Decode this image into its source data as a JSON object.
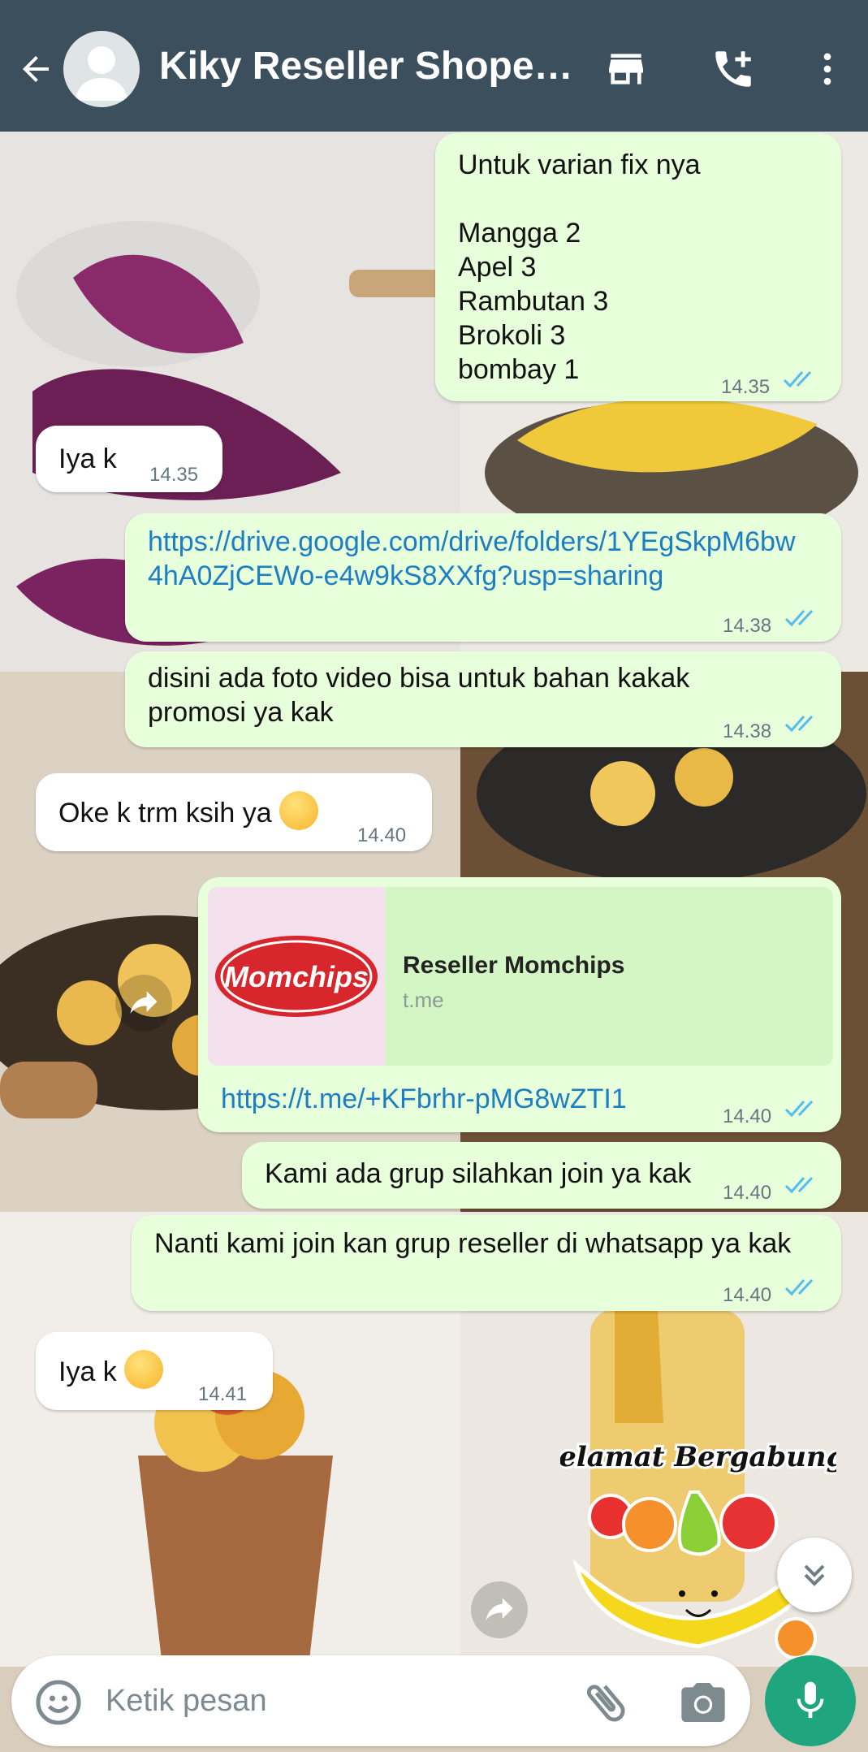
{
  "header": {
    "title": "Kiky Reseller Shopee...",
    "icons": [
      "back-arrow-icon",
      "avatar",
      "store-icon",
      "add-call-icon",
      "more-vert-icon"
    ]
  },
  "colors": {
    "header_bg": "#3c4f5c",
    "outgoing_bubble": "#e7ffdb",
    "incoming_bubble": "#ffffff",
    "link": "#1d7ec3",
    "read_ticks": "#53bdeb",
    "mic_button": "#1fa67f"
  },
  "messages": [
    {
      "direction": "out",
      "text": "Untuk varian fix nya\n\nMangga 2\nApel 3\nRambutan 3\nBrokoli 3\nbombay 1",
      "time": "14.35",
      "status": "read"
    },
    {
      "direction": "in",
      "text": "Iya k",
      "time": "14.35"
    },
    {
      "direction": "out",
      "text": "https://drive.google.com/drive/folders/1YEgSkpM6bw4hA0ZjCEWo-e4w9kS8XXfg?usp=sharing",
      "time": "14.38",
      "status": "read",
      "is_link": true
    },
    {
      "direction": "out",
      "text": "disini ada foto video bisa untuk bahan kakak promosi ya kak",
      "time": "14.38",
      "status": "read"
    },
    {
      "direction": "in",
      "text": "Oke k trm ksih ya",
      "emoji": "smiling-face-icon",
      "time": "14.40"
    },
    {
      "direction": "out",
      "preview_title": "Reseller Momchips",
      "preview_domain": "t.me",
      "preview_logo_text": "Momchips",
      "text": "https://t.me/+KFbrhr-pMG8wZTI1",
      "time": "14.40",
      "status": "read",
      "is_link": true
    },
    {
      "direction": "out",
      "text": "Kami ada grup silahkan join ya kak",
      "time": "14.40",
      "status": "read"
    },
    {
      "direction": "out",
      "text": "Nanti kami join kan grup reseller di whatsapp ya kak",
      "time": "14.40",
      "status": "read"
    },
    {
      "direction": "in",
      "text": "Iya k",
      "emoji": "smiling-face-icon",
      "time": "14.41"
    },
    {
      "direction": "in",
      "type": "sticker",
      "sticker_text": "Selamat Bergabung!"
    }
  ],
  "input": {
    "placeholder": "Ketik pesan"
  }
}
